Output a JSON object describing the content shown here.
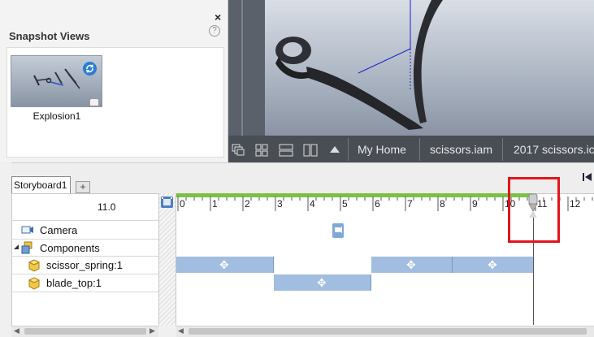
{
  "snapshot_panel": {
    "title": "Snapshot Views",
    "close_symbol": "×",
    "help_symbol": "?",
    "views": [
      {
        "label": "Explosion1",
        "icon": "refresh-icon"
      }
    ]
  },
  "view_bar": {
    "items": [
      {
        "label": "My Home"
      },
      {
        "label": "scissors.iam"
      },
      {
        "label": "2017 scissors.ic"
      }
    ],
    "icons": [
      "window-cascade-icon",
      "window-tile-icon",
      "window-horizontal-icon",
      "window-vertical-icon",
      "expand-up-icon"
    ]
  },
  "storyboard": {
    "tabs": [
      {
        "label": "Storyboard1"
      }
    ],
    "add_tab_symbol": "+",
    "current_time": "11.0",
    "ruler_ticks": [
      "0",
      "1",
      "2",
      "3",
      "4",
      "5",
      "6",
      "7",
      "8",
      "9",
      "10",
      "11",
      "12"
    ],
    "rows": [
      {
        "label": "Camera",
        "icon": "camera-icon"
      },
      {
        "label": "Components",
        "icon": "components-icon",
        "expanded": true
      },
      {
        "label": "scissor_spring:1",
        "icon": "part-icon"
      },
      {
        "label": "blade_top:1",
        "icon": "part-icon"
      }
    ],
    "bars": [
      {
        "row": "scissor_spring:1",
        "start": 0,
        "end": 3
      },
      {
        "row": "scissor_spring:1",
        "start": 6,
        "end": 8.5
      },
      {
        "row": "scissor_spring:1",
        "start": 8.5,
        "end": 11
      },
      {
        "row": "blade_top:1",
        "start": 3,
        "end": 6
      }
    ],
    "camera_marker_time": 5,
    "playhead_time": 11
  },
  "colors": {
    "accent_blue": "#2a7ed2",
    "bar_blue": "#a1bde0",
    "ruler_green": "#7cc047",
    "highlight_red": "#e3141c",
    "view_bar_bg": "#494d54"
  }
}
